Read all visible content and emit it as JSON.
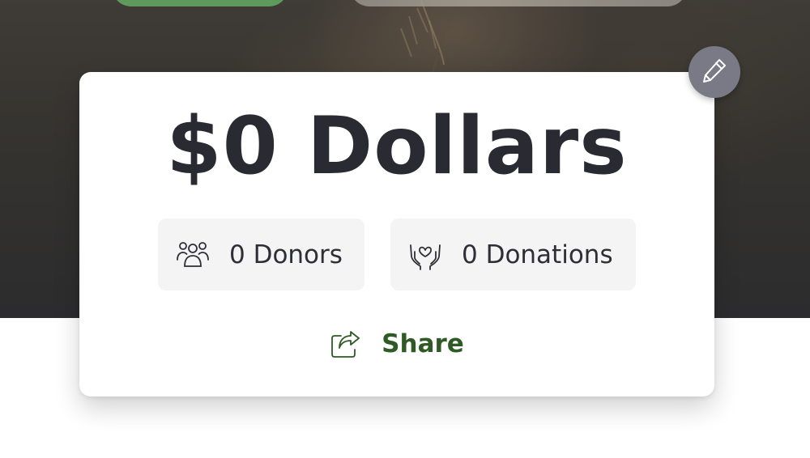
{
  "campaign": {
    "amount_label": "$0 Dollars",
    "stats": {
      "donors_label": "0 Donors",
      "donations_label": "0 Donations"
    },
    "share_label": "Share"
  },
  "icons": {
    "edit": "pencil-icon",
    "donors": "users-icon",
    "donations": "hands-heart-icon",
    "share": "share-icon"
  },
  "colors": {
    "accent_green": "#2f5a25",
    "pill_green": "#5f9a5d",
    "edit_button": "#7a7a86",
    "stat_background": "#f4f4f5",
    "text_dark": "#2a2a33"
  }
}
